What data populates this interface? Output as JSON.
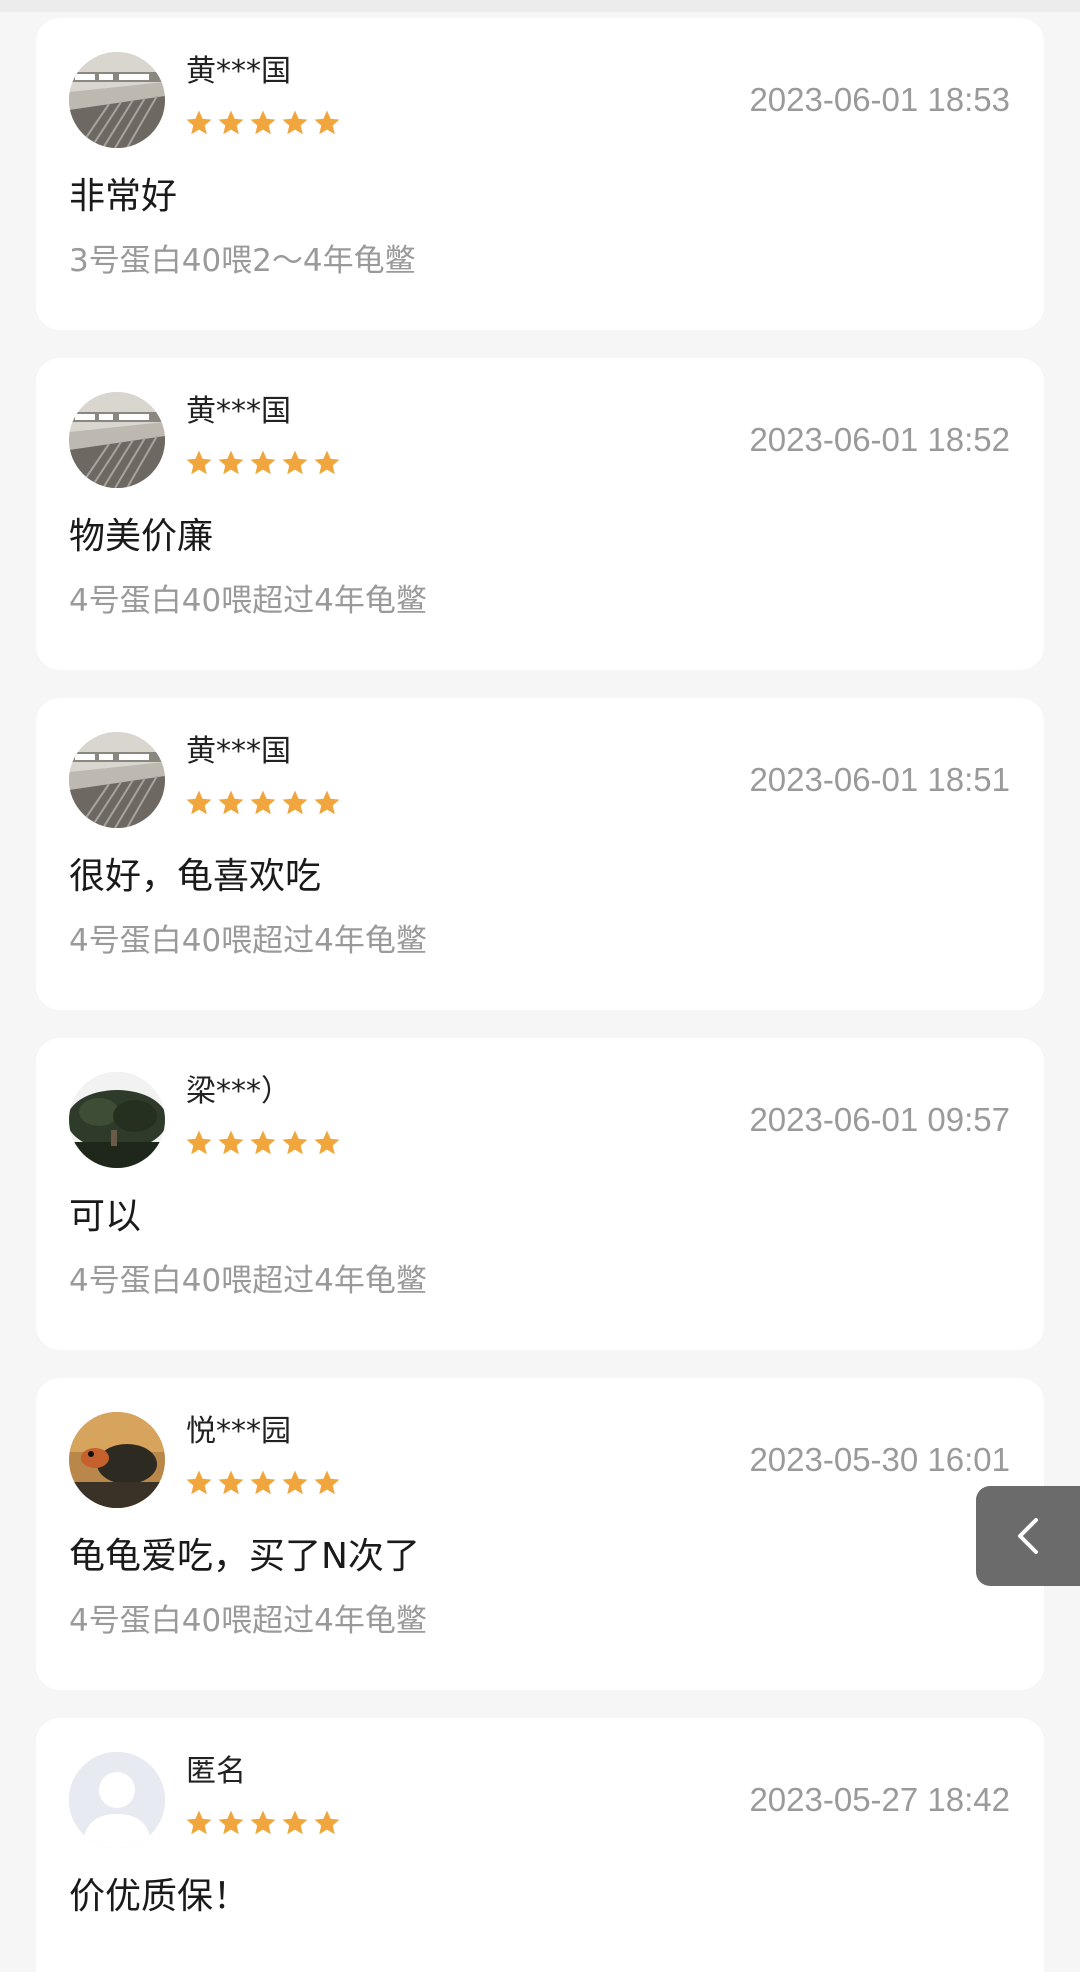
{
  "colors": {
    "background": "#f6f6f6",
    "card": "#ffffff",
    "star": "#f0a63c",
    "timestamp": "#9a9a9a",
    "spec": "#9a9a9a",
    "back_tab": "#6b6b6b"
  },
  "reviews": [
    {
      "username": "黄***国",
      "rating": 5,
      "timestamp": "2023-06-01 18:53",
      "comment": "非常好",
      "spec": "3号蛋白40喂2～4年龟鳖",
      "avatar": "escalator-photo"
    },
    {
      "username": "黄***国",
      "rating": 5,
      "timestamp": "2023-06-01 18:52",
      "comment": "物美价廉",
      "spec": "4号蛋白40喂超过4年龟鳖",
      "avatar": "escalator-photo"
    },
    {
      "username": "黄***国",
      "rating": 5,
      "timestamp": "2023-06-01 18:51",
      "comment": "很好，龟喜欢吃",
      "spec": "4号蛋白40喂超过4年龟鳖",
      "avatar": "escalator-photo"
    },
    {
      "username": "梁***）",
      "rating": 5,
      "timestamp": "2023-06-01 09:57",
      "comment": "可以",
      "spec": "4号蛋白40喂超过4年龟鳖",
      "avatar": "tree-photo"
    },
    {
      "username": "悦***园",
      "rating": 5,
      "timestamp": "2023-05-30 16:01",
      "comment": "龟龟爱吃，买了N次了",
      "spec": "4号蛋白40喂超过4年龟鳖",
      "avatar": "turtle-photo"
    },
    {
      "username": "匿名",
      "rating": 5,
      "timestamp": "2023-05-27 18:42",
      "comment": "价优质保！",
      "spec": "",
      "avatar": "default-user"
    }
  ],
  "back_tab": {
    "icon": "chevron-left-icon"
  }
}
